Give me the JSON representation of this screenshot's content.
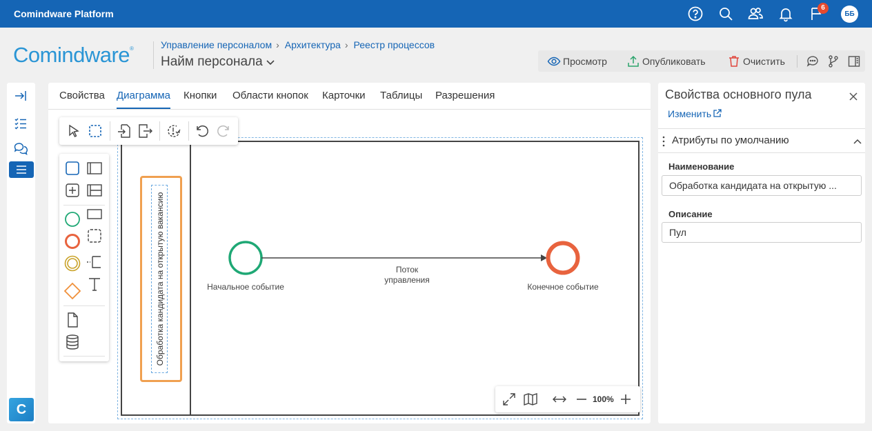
{
  "app": {
    "title": "Comindware Platform"
  },
  "topbar": {
    "notifications_count": "6",
    "user_initials": "ББ"
  },
  "brand": {
    "logo_text": "Comindware",
    "logo_mark": "®"
  },
  "breadcrumb": [
    "Управление персоналом",
    "Архитектура",
    "Реестр процессов"
  ],
  "page": {
    "title": "Найм персонала"
  },
  "actions": {
    "view": "Просмотр",
    "publish": "Опубликовать",
    "clear": "Очистить"
  },
  "tabs": [
    "Свойства",
    "Диаграмма",
    "Кнопки",
    "Области кнопок",
    "Карточки",
    "Таблицы",
    "Разрешения"
  ],
  "active_tab": "Диаграмма",
  "diagram": {
    "pool_label": "Обработка кандидата на открытую вакансию",
    "start_event": "Начальное событие",
    "end_event": "Конечное событие",
    "flow_line1": "Поток",
    "flow_line2": "управления",
    "zoom": "100%"
  },
  "properties": {
    "title": "Свойства основного пула",
    "edit_link": "Изменить",
    "section": "Атрибуты по умолчанию",
    "name_label": "Наименование",
    "name_value": "Обработка кандидата на открытую ...",
    "description_label": "Описание",
    "description_value": "Пул"
  },
  "colors": {
    "brand_blue": "#1565b5",
    "start_event": "#1fa875",
    "end_event": "#e8633e",
    "selection": "#f0a050",
    "badge": "#e64a2e"
  }
}
